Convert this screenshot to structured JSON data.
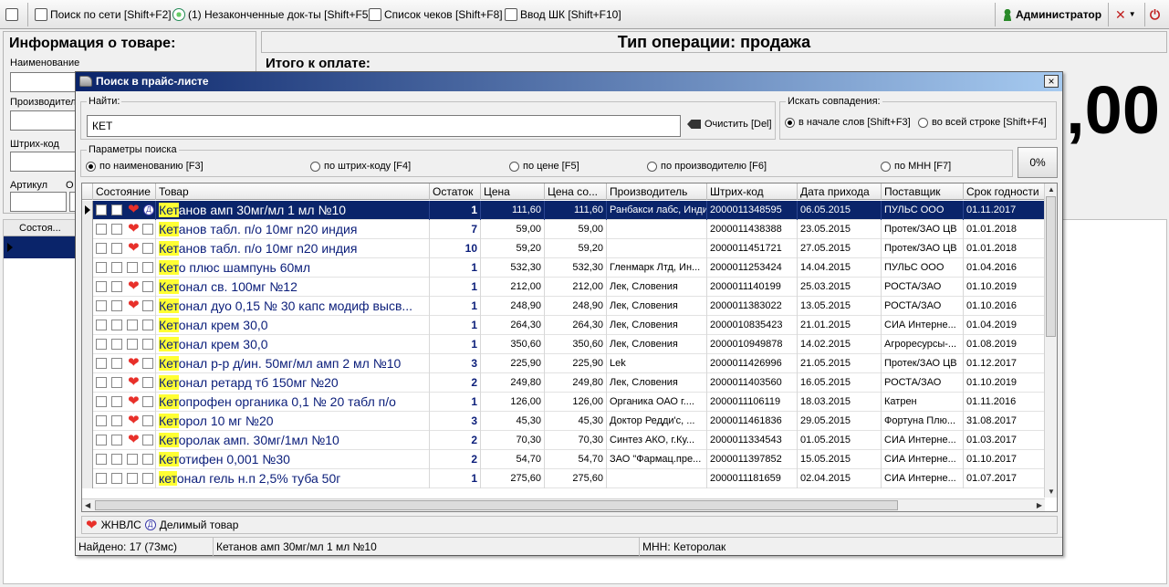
{
  "toolbar": {
    "network_search": "Поиск по сети [Shift+F2]",
    "unfinished_docs": "(1) Незаконченные док-ты [Shift+F5]",
    "receipts_list": "Список чеков [Shift+F8]",
    "barcode_input": "Ввод ШК [Shift+F10]",
    "user": "Администратор"
  },
  "product_info": {
    "title": "Информация о товаре:",
    "name_label": "Наименование",
    "manufacturer_label": "Производител",
    "barcode_label": "Штрих-код",
    "article_label": "Артикул",
    "extra_label": "О"
  },
  "operation": {
    "title": "Тип операции: продажа",
    "total_label": "Итого к оплате:",
    "amount": ",00"
  },
  "bg_grid": {
    "state_header": "Состоя..."
  },
  "dialog": {
    "title": "Поиск в прайс-листе",
    "close": "×",
    "find_label": "Найти:",
    "find_value": "КЕТ",
    "clear": "Очистить [Del]",
    "match_label": "Искать совпадения:",
    "match_start": "в начале слов [Shift+F3]",
    "match_anywhere": "во всей строке [Shift+F4]",
    "params_label": "Параметры поиска",
    "by_name": "по наименованию [F3]",
    "by_barcode": "по штрих-коду [F4]",
    "by_price": "по цене [F5]",
    "by_manufacturer": "по производителю [F6]",
    "by_mnn": "по МНН [F7]",
    "progress": "0%"
  },
  "grid": {
    "columns": [
      "Состояние",
      "Товар",
      "Остаток",
      "Цена",
      "Цена со...",
      "Производитель",
      "Штрих-код",
      "Дата прихода",
      "Поставщик",
      "Срок годности"
    ],
    "rows": [
      {
        "hl": "Кет",
        "rest": "анов амп  30мг/мл 1 мл №10",
        "heart": true,
        "d": true,
        "stock": "1",
        "price": "111,60",
        "price2": "111,60",
        "mfr": "Ранбакси лабс, Инди...",
        "barcode": "2000011348595",
        "date": "06.05.2015",
        "supplier": "ПУЛЬС ООО",
        "expiry": "01.11.2017"
      },
      {
        "hl": "Кет",
        "rest": "анов табл. п/о 10мг n20 индия",
        "heart": true,
        "d": false,
        "stock": "7",
        "price": "59,00",
        "price2": "59,00",
        "mfr": "",
        "barcode": "2000011438388",
        "date": "23.05.2015",
        "supplier": "Протек/ЗАО ЦВ",
        "expiry": "01.01.2018"
      },
      {
        "hl": "Кет",
        "rest": "анов табл. п/о 10мг n20 индия",
        "heart": true,
        "d": false,
        "stock": "10",
        "price": "59,20",
        "price2": "59,20",
        "mfr": "",
        "barcode": "2000011451721",
        "date": "27.05.2015",
        "supplier": "Протек/ЗАО ЦВ",
        "expiry": "01.01.2018"
      },
      {
        "hl": "Кет",
        "rest": "о плюс шампунь 60мл",
        "heart": false,
        "d": false,
        "stock": "1",
        "price": "532,30",
        "price2": "532,30",
        "mfr": "Гленмарк Лтд, Ин...",
        "barcode": "2000011253424",
        "date": "14.04.2015",
        "supplier": "ПУЛЬС ООО",
        "expiry": "01.04.2016"
      },
      {
        "hl": "Кет",
        "rest": "онал  св. 100мг №12",
        "heart": true,
        "d": false,
        "stock": "1",
        "price": "212,00",
        "price2": "212,00",
        "mfr": "Лек, Словения",
        "barcode": "2000011140199",
        "date": "25.03.2015",
        "supplier": "РОСТА/ЗАО",
        "expiry": "01.10.2019"
      },
      {
        "hl": "Кет",
        "rest": "онал дуо 0,15 № 30 капс модиф высв...",
        "heart": true,
        "d": false,
        "stock": "1",
        "price": "248,90",
        "price2": "248,90",
        "mfr": "Лек, Словения",
        "barcode": "2000011383022",
        "date": "13.05.2015",
        "supplier": "РОСТА/ЗАО",
        "expiry": "01.10.2016"
      },
      {
        "hl": "Кет",
        "rest": "онал крем 30,0",
        "heart": false,
        "d": false,
        "stock": "1",
        "price": "264,30",
        "price2": "264,30",
        "mfr": "Лек, Словения",
        "barcode": "2000010835423",
        "date": "21.01.2015",
        "supplier": "СИА Интерне...",
        "expiry": "01.04.2019"
      },
      {
        "hl": "Кет",
        "rest": "онал крем 30,0",
        "heart": false,
        "d": false,
        "stock": "1",
        "price": "350,60",
        "price2": "350,60",
        "mfr": "Лек, Словения",
        "barcode": "2000010949878",
        "date": "14.02.2015",
        "supplier": "Агроресурсы-...",
        "expiry": "01.08.2019"
      },
      {
        "hl": "Кет",
        "rest": "онал р-р д/ин. 50мг/мл амп 2 мл №10",
        "heart": true,
        "d": false,
        "stock": "3",
        "price": "225,90",
        "price2": "225,90",
        "mfr": "Lek",
        "barcode": "2000011426996",
        "date": "21.05.2015",
        "supplier": "Протек/ЗАО ЦВ",
        "expiry": "01.12.2017"
      },
      {
        "hl": "Кет",
        "rest": "онал ретард тб  150мг №20",
        "heart": true,
        "d": false,
        "stock": "2",
        "price": "249,80",
        "price2": "249,80",
        "mfr": "Лек, Словения",
        "barcode": "2000011403560",
        "date": "16.05.2015",
        "supplier": "РОСТА/ЗАО",
        "expiry": "01.10.2019"
      },
      {
        "hl": "Кет",
        "rest": "опрофен органика 0,1 № 20 табл п/о",
        "heart": true,
        "d": false,
        "stock": "1",
        "price": "126,00",
        "price2": "126,00",
        "mfr": "Органика ОАО г....",
        "barcode": "2000011106119",
        "date": "18.03.2015",
        "supplier": "Катрен",
        "expiry": "01.11.2016"
      },
      {
        "hl": "Кет",
        "rest": "орол 10 мг №20",
        "heart": true,
        "d": false,
        "stock": "3",
        "price": "45,30",
        "price2": "45,30",
        "mfr": "Доктор Редди'с, ...",
        "barcode": "2000011461836",
        "date": "29.05.2015",
        "supplier": "Фортуна Плю...",
        "expiry": "31.08.2017"
      },
      {
        "hl": "Кет",
        "rest": "оролак амп. 30мг/1мл №10",
        "heart": true,
        "d": false,
        "stock": "2",
        "price": "70,30",
        "price2": "70,30",
        "mfr": "Синтез АКО, г.Ку...",
        "barcode": "2000011334543",
        "date": "01.05.2015",
        "supplier": "СИА Интерне...",
        "expiry": "01.03.2017"
      },
      {
        "hl": "Кет",
        "rest": "отифен 0,001 №30",
        "heart": false,
        "d": false,
        "stock": "2",
        "price": "54,70",
        "price2": "54,70",
        "mfr": "ЗАО \"Фармац.пре...",
        "barcode": "2000011397852",
        "date": "15.05.2015",
        "supplier": "СИА Интерне...",
        "expiry": "01.10.2017"
      },
      {
        "hl": "кет",
        "rest": "онал гель н.п 2,5% туба 50г",
        "heart": false,
        "d": false,
        "stock": "1",
        "price": "275,60",
        "price2": "275,60",
        "mfr": "",
        "barcode": "2000011181659",
        "date": "02.04.2015",
        "supplier": "СИА Интерне...",
        "expiry": "01.07.2017"
      }
    ]
  },
  "legend": {
    "vital": "ЖНВЛС",
    "divisible": "Делимый товар"
  },
  "status": {
    "found": "Найдено: 17 (73мс)",
    "current": "Кетанов амп  30мг/мл 1 мл №10",
    "mnn": "МНН: Кеторолак"
  }
}
